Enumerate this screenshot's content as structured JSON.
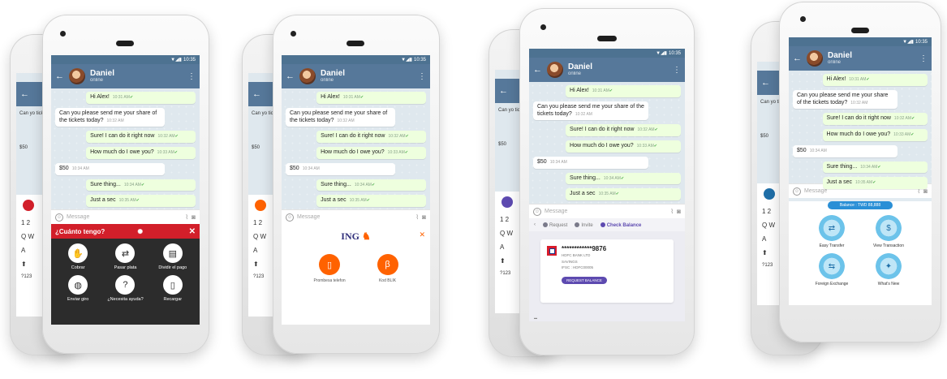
{
  "chat": {
    "name": "Daniel",
    "status": "online",
    "time": "10:35",
    "messages": [
      {
        "dir": "out",
        "text": "Hi Alex!",
        "time": "10:31 AM"
      },
      {
        "dir": "in",
        "text": "Can you please send me your share of the tickets today?",
        "time": "10:32 AM"
      },
      {
        "dir": "out",
        "text": "Sure! I can do it right now",
        "time": "10:32 AM"
      },
      {
        "dir": "out",
        "text": "How much do I owe you?",
        "time": "10:33 AM"
      },
      {
        "dir": "in",
        "text": "$50",
        "time": "10:34 AM"
      },
      {
        "dir": "out",
        "text": "Sure thing...",
        "time": "10:34 AM"
      },
      {
        "dir": "out",
        "text": "Just a sec",
        "time": "10:35 AM"
      }
    ],
    "input_placeholder": "Message",
    "back_preview": "Can yo tickets",
    "back_amount": "$50"
  },
  "panel1": {
    "title": "¿Cuánto tengo?",
    "accent": "#d21f2a",
    "items": [
      {
        "label": "Cobrar",
        "icon": "hand-coin-icon"
      },
      {
        "label": "Pasar plata",
        "icon": "transfer-icon"
      },
      {
        "label": "Dividir el pago",
        "icon": "split-icon"
      },
      {
        "label": "Enviar giro",
        "icon": "globe-icon"
      },
      {
        "label": "¿Necesita ayuda?",
        "icon": "help-icon"
      },
      {
        "label": "Recargar",
        "icon": "phone-icon"
      }
    ]
  },
  "panel2": {
    "logo": "ING",
    "accent": "#ff6200",
    "items": [
      {
        "label": "Prombesa telefon",
        "icon": "phone-icon"
      },
      {
        "label": "Kod BLIK",
        "icon": "blik-icon"
      }
    ]
  },
  "panel3": {
    "tabs": [
      "Request",
      "Invite",
      "Check Balance"
    ],
    "active_tab": "Check Balance",
    "account_number": "************9876",
    "bank": "HDFC BANK LTD",
    "type": "SAVINGS",
    "ifsc": "IFSC : HDFC00005",
    "button": "REQUEST BALANCE",
    "accent": "#5d4ab0"
  },
  "panel4": {
    "balance": "Balance : TWD 88,888",
    "items": [
      {
        "label": "Easy Transfer",
        "icon": "transfer-icon"
      },
      {
        "label": "View Transaction",
        "icon": "receipt-icon"
      },
      {
        "label": "Foreign Exchange",
        "icon": "exchange-icon"
      },
      {
        "label": "What's New",
        "icon": "news-icon"
      }
    ]
  },
  "keyboard": {
    "row1": "1 2",
    "row2": "Q W",
    "row3": "A",
    "shift": "⬆",
    "sym": "?123"
  }
}
